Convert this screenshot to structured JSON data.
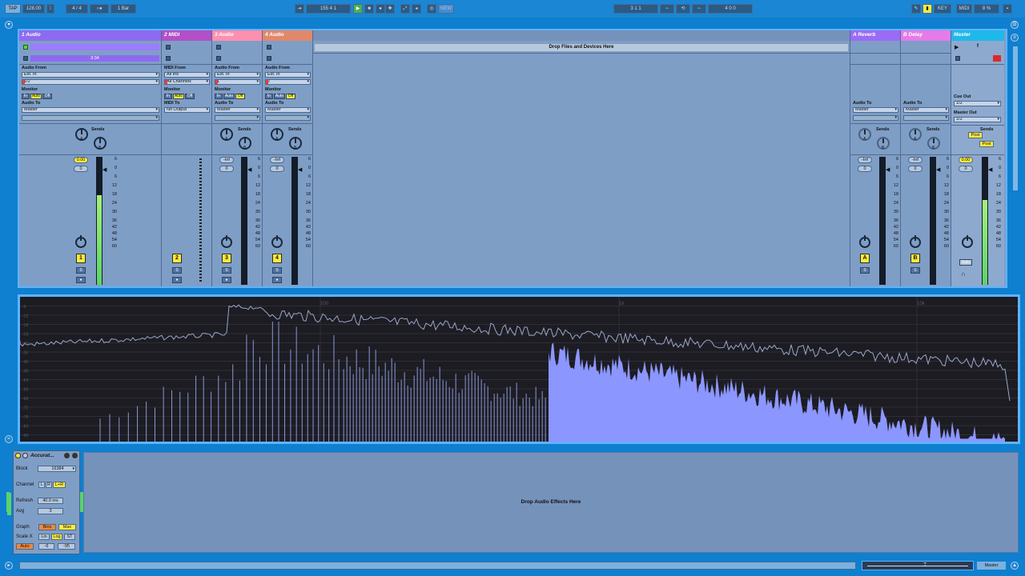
{
  "transport": {
    "tap": "TAP",
    "tempo": "128.00",
    "signature": "4  /  4",
    "quantize": "1 Bar",
    "position": "155      4      1",
    "nudge_label": "NEW",
    "loop_start": "3      1      1",
    "loop_length": "4      0      0",
    "key_label": "KEY",
    "midi_label": "MIDI",
    "cpu": "8 %"
  },
  "tracks": [
    {
      "name": "1 Audio",
      "color": "#8d6bf0",
      "clip_time": "3:34",
      "io_from_label": "Audio From",
      "io_from": "Ext. In",
      "io_channel": "1/2",
      "monitor_label": "Monitor",
      "monitor": [
        "In",
        "Auto",
        "Off"
      ],
      "io_to_label": "Audio To",
      "io_to": "Master",
      "sends_label": "Sends",
      "send_a": "A",
      "send_b": "B",
      "vol": "0.00",
      "pan": "0",
      "number": "1",
      "solo": "S",
      "arm": "●"
    },
    {
      "name": "2 MIDI",
      "color": "#b34fc7",
      "io_from_label": "MIDI From",
      "io_from": "All Ins",
      "io_channel": "All Channels",
      "monitor_label": "Monitor",
      "monitor": [
        "In",
        "Auto",
        "Off"
      ],
      "io_to_label": "MIDI To",
      "io_to": "No Output",
      "number": "2",
      "solo": "S",
      "arm": "●"
    },
    {
      "name": "3 Audio",
      "color": "#ff8fb0",
      "io_from_label": "Audio From",
      "io_from": "Ext. In",
      "io_channel": "1",
      "monitor_label": "Monitor",
      "monitor": [
        "In",
        "Auto",
        "Off"
      ],
      "io_to_label": "Audio To",
      "io_to": "Master",
      "sends_label": "Sends",
      "send_a": "A",
      "send_b": "B",
      "vol": "-Inf",
      "pan": "0",
      "number": "3",
      "solo": "S",
      "arm": "●"
    },
    {
      "name": "4 Audio",
      "color": "#e2886a",
      "io_from_label": "Audio From",
      "io_from": "Ext. In",
      "io_channel": "2",
      "monitor_label": "Monitor",
      "monitor": [
        "In",
        "Auto",
        "Off"
      ],
      "io_to_label": "Audio To",
      "io_to": "Master",
      "sends_label": "Sends",
      "send_a": "A",
      "send_b": "B",
      "vol": "-Inf",
      "pan": "0",
      "number": "4",
      "solo": "S",
      "arm": "●"
    }
  ],
  "returns": [
    {
      "name": "A Reverb",
      "color": "#9b6bf5",
      "io_to_label": "Audio To",
      "io_to": "Master",
      "sends_label": "Sends",
      "send_a": "A",
      "send_b": "B",
      "vol": "-Inf",
      "pan": "0",
      "number": "A",
      "solo": "S"
    },
    {
      "name": "B Delay",
      "color": "#e57be8",
      "io_to_label": "Audio To",
      "io_to": "Master",
      "sends_label": "Sends",
      "send_a": "A",
      "send_b": "B",
      "vol": "-Inf",
      "pan": "0",
      "number": "B",
      "solo": "S"
    }
  ],
  "master": {
    "name": "Master",
    "color": "#1fb8ea",
    "scene": "f",
    "cue_label": "Cue Out",
    "cue": "1/2",
    "out_label": "Master Out",
    "out": "1/2",
    "sends_label": "Sends",
    "post_a": "Post",
    "post_b": "Post",
    "vol": "0.00",
    "pan": "0",
    "solo_label": "Solo"
  },
  "drop_files": "Drop Files and Devices Here",
  "meter_scale": [
    "6",
    "0",
    "6",
    "12",
    "18",
    "24",
    "30",
    "36",
    "42",
    "48",
    "54",
    "60"
  ],
  "spectrum": {
    "freq_labels": [
      "100",
      "1k",
      "10k"
    ],
    "db_labels": [
      "-6",
      "-12",
      "-18",
      "-24",
      "-30",
      "-36",
      "-42",
      "-48",
      "-54",
      "-60",
      "-66",
      "-72",
      "-78",
      "-84",
      "-90"
    ]
  },
  "device": {
    "title": "Accurat...",
    "block_label": "Block",
    "block": "16384",
    "channel_label": "Channel",
    "channel": [
      "L",
      "R",
      "L+R"
    ],
    "refresh_label": "Refresh",
    "refresh": "40.0 ms",
    "avg_label": "Avg",
    "avg": "3",
    "graph_label": "Graph",
    "graph": [
      "Bins",
      "Max"
    ],
    "scalex_label": "Scale X",
    "scalex": [
      "Lin",
      "Log",
      "ST"
    ],
    "auto": "Auto",
    "range_lo": "-6",
    "range_hi": "-95"
  },
  "drop_effects": "Drop Audio Effects Here",
  "status_master": "Master"
}
